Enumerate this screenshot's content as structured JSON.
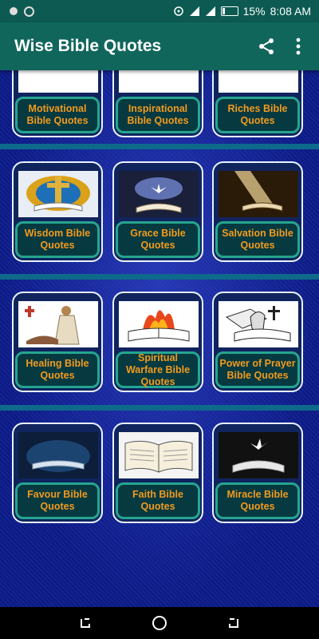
{
  "status": {
    "battery": "15%",
    "time": "8:08 AM"
  },
  "app": {
    "title": "Wise Bible Quotes",
    "share_icon": "share-icon",
    "menu_icon": "more-vert-icon"
  },
  "categories": [
    {
      "label": "Motivational Bible Quotes"
    },
    {
      "label": "Inspirational Bible Quotes"
    },
    {
      "label": "Riches Bible Quotes"
    },
    {
      "label": "Wisdom Bible Quotes"
    },
    {
      "label": "Grace Bible Quotes"
    },
    {
      "label": "Salvation Bible Quotes"
    },
    {
      "label": "Healing Bible Quotes"
    },
    {
      "label": "Spiritual Warfare Bible Quotes"
    },
    {
      "label": "Power of Prayer Bible Quotes"
    },
    {
      "label": "Favour Bible Quotes"
    },
    {
      "label": "Faith Bible Quotes"
    },
    {
      "label": "Miracle Bible Quotes"
    }
  ],
  "colors": {
    "toolbar": "#11665c",
    "label_text": "#f39a1e",
    "label_border": "#25a58f"
  }
}
